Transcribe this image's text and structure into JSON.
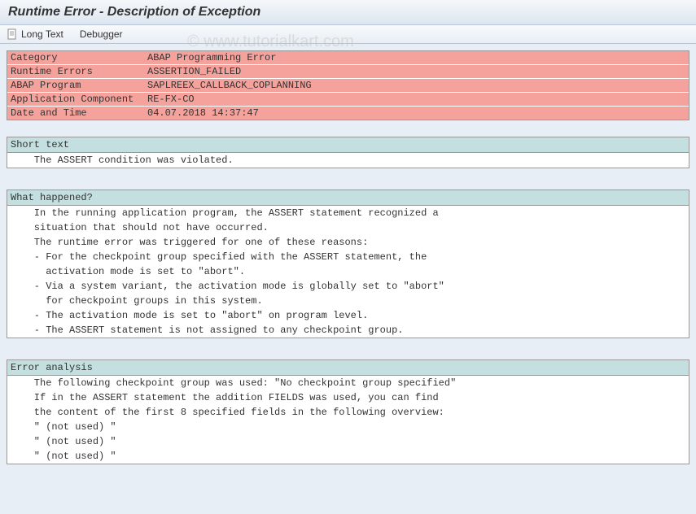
{
  "title": "Runtime Error - Description of Exception",
  "watermark": "© www.tutorialkart.com",
  "toolbar": {
    "long_text": "Long Text",
    "debugger": "Debugger"
  },
  "summary": {
    "rows": [
      {
        "label": "Category",
        "value": "ABAP Programming Error"
      },
      {
        "label": "Runtime Errors",
        "value": "ASSERTION_FAILED"
      },
      {
        "label": "ABAP Program",
        "value": "SAPLREEX_CALLBACK_COPLANNING"
      },
      {
        "label": "Application Component",
        "value": "RE-FX-CO"
      },
      {
        "label": "Date and Time",
        "value": "04.07.2018 14:37:47"
      }
    ]
  },
  "sections": {
    "short_text": {
      "header": "Short text",
      "lines": [
        "    The ASSERT condition was violated."
      ]
    },
    "what_happened": {
      "header": "What happened?",
      "lines": [
        "    In the running application program, the ASSERT statement recognized a",
        "    situation that should not have occurred.",
        "    The runtime error was triggered for one of these reasons:",
        "    - For the checkpoint group specified with the ASSERT statement, the",
        "      activation mode is set to \"abort\".",
        "    - Via a system variant, the activation mode is globally set to \"abort\"",
        "      for checkpoint groups in this system.",
        "    - The activation mode is set to \"abort\" on program level.",
        "    - The ASSERT statement is not assigned to any checkpoint group."
      ]
    },
    "error_analysis": {
      "header": "Error analysis",
      "lines": [
        "    The following checkpoint group was used: \"No checkpoint group specified\"",
        "",
        "    If in the ASSERT statement the addition FIELDS was used, you can find",
        "    the content of the first 8 specified fields in the following overview:",
        "    \" (not used) \"",
        "    \" (not used) \"",
        "    \" (not used) \""
      ]
    }
  }
}
